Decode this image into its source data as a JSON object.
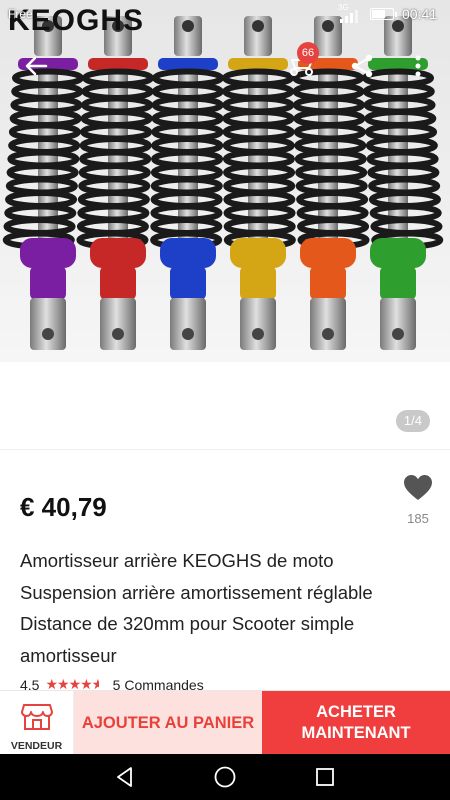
{
  "status_bar": {
    "left_text": "Free",
    "network": "3G",
    "time": "00:41"
  },
  "hero": {
    "brand": "KEOGHS",
    "image_counter": "1/4",
    "cart_count": "66",
    "shock_colors": [
      "#7b1fa2",
      "#c62828",
      "#1e40c8",
      "#d4a514",
      "#e4581c",
      "#2e9e2e"
    ]
  },
  "product": {
    "price": "€ 40,79",
    "wishlist_count": "185",
    "title": "Amortisseur arrière KEOGHS de moto Suspension arrière amortissement réglable Distance de 320mm pour Scooter simple amortisseur",
    "rating": "4.5",
    "orders": "5 Commandes"
  },
  "actions": {
    "vendor_label": "VENDEUR",
    "add_to_cart": "AJOUTER AU PANIER",
    "buy_now": "ACHETER MAINTENANT"
  },
  "icons": {
    "back": "back-arrow-icon",
    "cart": "cart-icon",
    "share": "share-icon",
    "more": "more-vertical-icon",
    "heart": "heart-icon",
    "store": "store-icon"
  }
}
